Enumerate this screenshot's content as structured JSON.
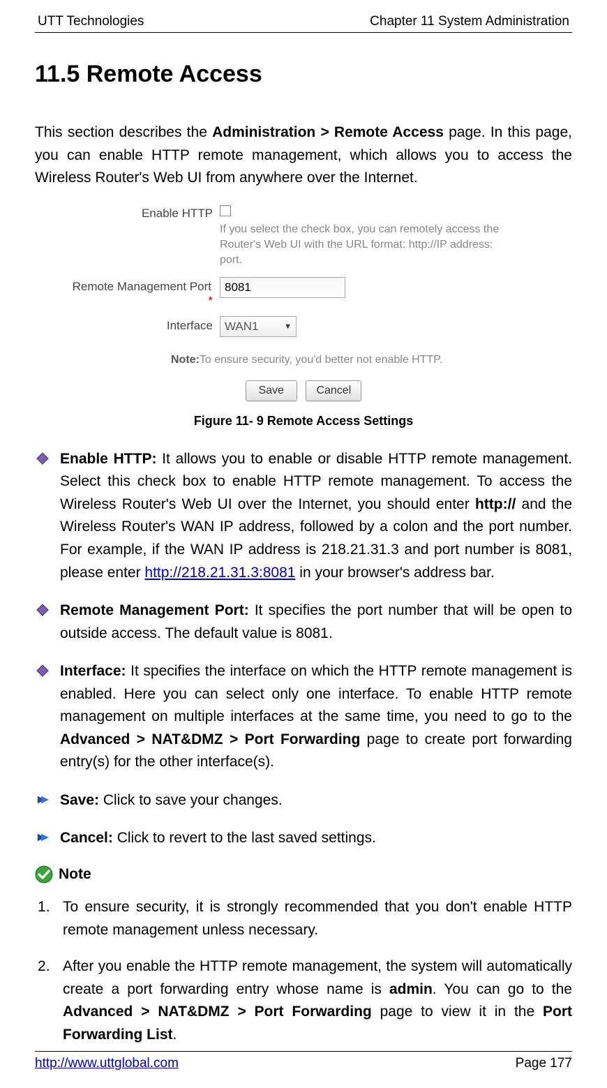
{
  "header": {
    "left": "UTT Technologies",
    "right": "Chapter 11 System Administration"
  },
  "title": "11.5   Remote Access",
  "intro_parts": {
    "pre": "This section describes the ",
    "bold": "Administration > Remote Access",
    "post": " page. In this page, you can enable HTTP remote management, which allows you to access the Wireless Router's Web UI from anywhere over the Internet."
  },
  "form": {
    "enable_http_label": "Enable HTTP",
    "enable_http_hint": "If you select the check box, you can remotely access the Router's Web UI with the URL format: http://IP address: port.",
    "port_label": "Remote Management Port",
    "port_value": "8081",
    "interface_label": "Interface",
    "interface_value": "WAN1",
    "note_prefix": "Note:",
    "note_text": "To ensure security, you'd better not enable HTTP.",
    "save_btn": "Save",
    "cancel_btn": "Cancel"
  },
  "figure_caption": "Figure 11- 9 Remote Access Settings",
  "items": {
    "enable_http": {
      "label": "Enable HTTP:",
      "t1": " It allows you to enable or disable HTTP remote management. Select this check box to enable HTTP remote management. To access the Wireless Router's Web UI over the Internet, you should enter ",
      "b1": "http://",
      "t2": " and the Wireless Router's WAN IP address, followed by a colon and the port number. For example, if the WAN IP address is 218.21.31.3 and port number is 8081, please enter ",
      "link": "http://218.21.31.3:8081",
      "t3": " in your browser's address bar."
    },
    "port": {
      "label": "Remote Management Port:",
      "text": " It specifies the port number that will be open to outside access. The default value is 8081."
    },
    "iface": {
      "label": "Interface:",
      "t1": " It specifies the interface on which the HTTP remote management is enabled. Here you can select only one interface. To enable HTTP remote management on multiple interfaces at the same time, you need to go to the ",
      "b1": "Advanced > NAT&DMZ > Port Forwarding",
      "t2": " page to create port forwarding entry(s) for the other interface(s)."
    },
    "save": {
      "label": "Save:",
      "text": " Click to save your changes."
    },
    "cancel": {
      "label": "Cancel:",
      "text": " Click to revert to the last saved settings."
    }
  },
  "note_heading": "Note",
  "notes": {
    "n1": "To ensure security, it is strongly recommended that you don't enable HTTP remote management unless necessary.",
    "n2": {
      "t1": "After you enable the HTTP remote management, the system will automatically create a port forwarding entry whose name is ",
      "b1": "admin",
      "t2": ". You can go to the ",
      "b2": "Advanced > NAT&DMZ > Port Forwarding",
      "t3": " page to view it in the ",
      "b3": "Port Forwarding List",
      "t4": "."
    }
  },
  "footer": {
    "url": "http://www.uttglobal.com",
    "page": "Page 177"
  }
}
